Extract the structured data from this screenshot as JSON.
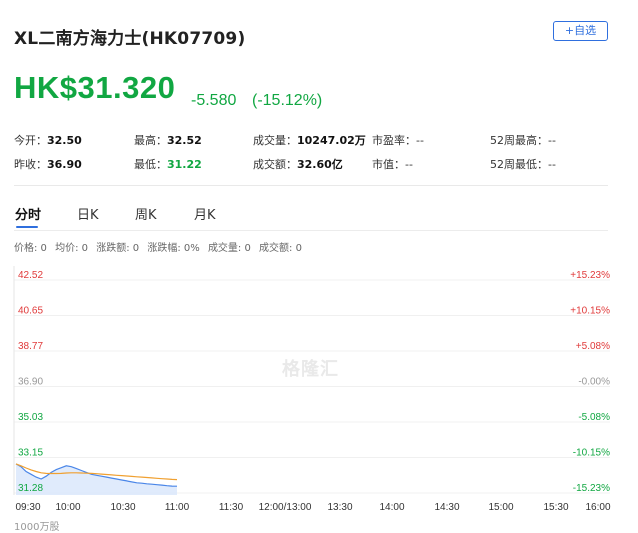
{
  "header": {
    "title": "XL二南方海力士(HK07709)",
    "watch_label": "+自选"
  },
  "quote": {
    "price": "HK$31.320",
    "change": "-5.580",
    "change_pct": "(-15.12%)",
    "color_down": "#11a742"
  },
  "stats": {
    "row1": [
      {
        "label": "今开：",
        "value": "32.50"
      },
      {
        "label": "最高：",
        "value": "32.52"
      },
      {
        "label": "成交量：",
        "value": "10247.02万"
      },
      {
        "label": "市盈率：",
        "value": "--"
      },
      {
        "label": "52周最高：",
        "value": "--"
      }
    ],
    "row2": [
      {
        "label": "昨收：",
        "value": "36.90"
      },
      {
        "label": "最低：",
        "value": "31.22"
      },
      {
        "label": "成交额：",
        "value": "32.60亿"
      },
      {
        "label": "市值：",
        "value": "--"
      },
      {
        "label": "52周最低：",
        "value": "--"
      }
    ]
  },
  "tabs": [
    "分时",
    "日K",
    "周K",
    "月K"
  ],
  "info_bar": [
    "价格: 0",
    "均价: 0",
    "涨跌额: 0",
    "涨跌幅: 0%",
    "成交量: 0",
    "成交额: 0"
  ],
  "watermark": "格隆汇",
  "volume_unit": "1000万股",
  "accent_color": "#2f6fde",
  "chart_data": {
    "type": "line",
    "y_left_ticks": [
      "42.52",
      "40.65",
      "38.77",
      "36.90",
      "35.03",
      "33.15",
      "31.28"
    ],
    "y_right_ticks": [
      "+15.23%",
      "+10.15%",
      "+5.08%",
      "-0.00%",
      "-5.08%",
      "-10.15%",
      "-15.23%"
    ],
    "x_ticks": [
      "09:30",
      "10:00",
      "10:30",
      "11:00",
      "11:30",
      "12:00/13:00",
      "13:30",
      "14:00",
      "14:30",
      "15:00",
      "15:30",
      "16:00"
    ],
    "ylim": [
      31.28,
      42.52
    ],
    "prev_close": 36.9,
    "series": [
      {
        "values": [
          32.5,
          32.35,
          32.1,
          31.95,
          31.8,
          31.7,
          31.85,
          32.05,
          32.2,
          32.3,
          32.4,
          32.35,
          32.25,
          32.15,
          32.05,
          31.95,
          31.9,
          31.85,
          31.8,
          31.75,
          31.7,
          31.65,
          31.6,
          31.55,
          31.5,
          31.48,
          31.45,
          31.43,
          31.4,
          31.38,
          31.35,
          31.33,
          31.32
        ]
      },
      {
        "values": [
          32.5,
          32.4,
          32.28,
          32.18,
          32.1,
          32.03,
          32.0,
          31.99,
          31.99,
          32.0,
          32.02,
          32.03,
          32.03,
          32.02,
          32.01,
          32.0,
          31.98,
          31.96,
          31.94,
          31.92,
          31.9,
          31.88,
          31.86,
          31.84,
          31.82,
          31.8,
          31.78,
          31.76,
          31.74,
          31.72,
          31.7,
          31.68,
          31.67
        ]
      }
    ]
  }
}
